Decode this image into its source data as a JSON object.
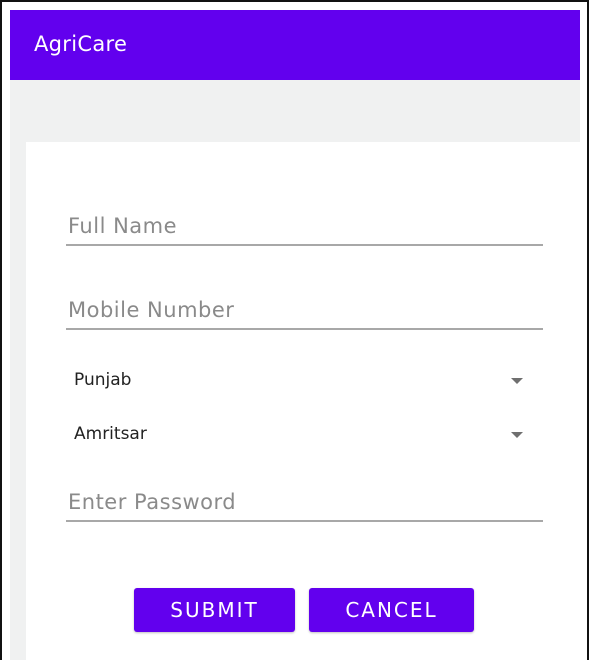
{
  "app": {
    "title": "AgriCare"
  },
  "form": {
    "full_name": {
      "placeholder": "Full Name",
      "value": ""
    },
    "mobile_number": {
      "placeholder": "Mobile Number",
      "value": ""
    },
    "state": {
      "selected": "Punjab"
    },
    "district": {
      "selected": "Amritsar"
    },
    "password": {
      "placeholder": "Enter Password",
      "value": ""
    }
  },
  "buttons": {
    "submit_label": "SUBMIT",
    "cancel_label": "CANCEL"
  },
  "colors": {
    "primary": "#6200ee",
    "background": "#f0f1f1",
    "hint_text": "#8a8a8a",
    "underline": "#a8a8a8"
  },
  "icons": {
    "dropdown": "dropdown-arrow-icon"
  }
}
